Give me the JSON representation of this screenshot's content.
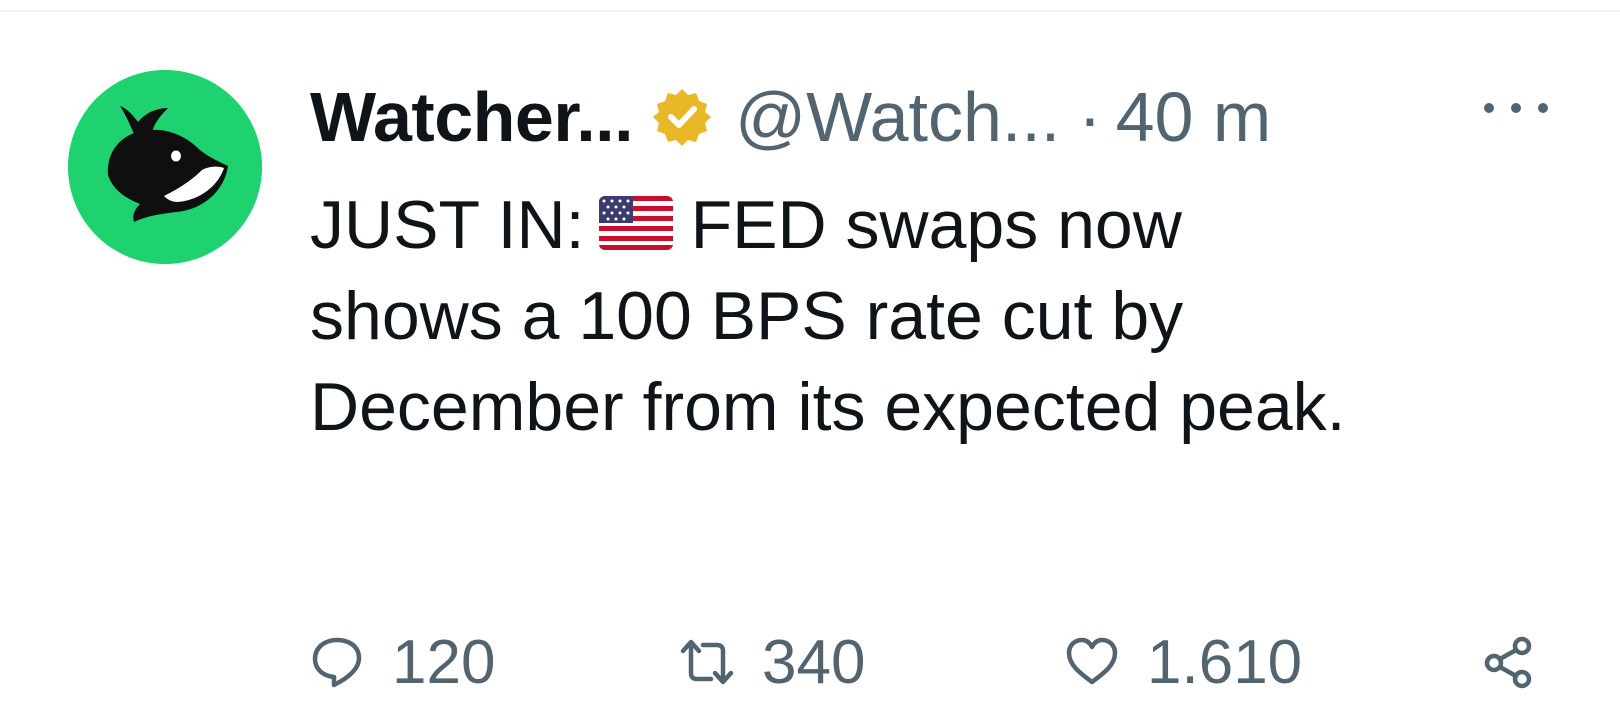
{
  "tweet": {
    "display_name": "Watcher...",
    "handle": "@Watch...",
    "separator": "·",
    "timestamp": "40 m",
    "text_before_flag": "JUST IN:",
    "text_after_flag": "FED swaps now shows a 100 BPS rate cut by December from its expected peak.",
    "verified_color": "#e8b829",
    "avatar_color": "#1ed36f"
  },
  "actions": {
    "reply_count": "120",
    "retweet_count": "340",
    "like_count": "1.610"
  },
  "icons": {
    "avatar": "whale-logo-icon",
    "verified": "verified-badge-icon",
    "flag": "us-flag-icon",
    "more": "more-options-icon",
    "reply": "reply-icon",
    "retweet": "retweet-icon",
    "like": "heart-icon",
    "share": "share-icon"
  }
}
